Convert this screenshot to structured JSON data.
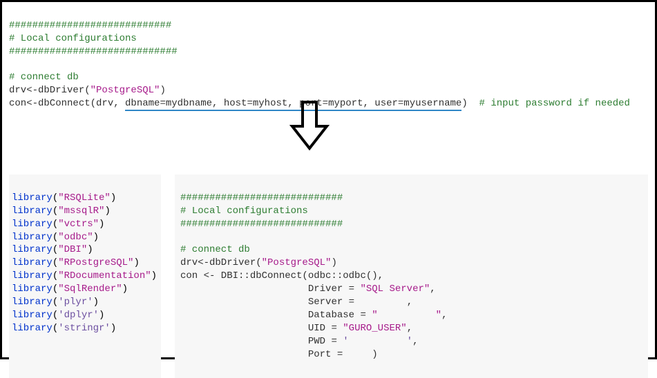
{
  "top": {
    "hash1": "############################",
    "title": "# Local configurations",
    "hash2": "#############################",
    "connect": "# connect db",
    "drv_prefix": "drv<-dbDriver(",
    "drv_str": "\"PostgreSQL\"",
    "drv_suffix": ")",
    "con_prefix": "con<-dbConnect(drv, ",
    "con_args_underlined": "dbname=mydbname, host=myhost, port=myport, user=myusername",
    "con_suffix": ")",
    "con_trailing_comment": "  # input password if needed"
  },
  "libs": [
    "\"RSQLite\"",
    "\"mssqlR\"",
    "\"vctrs\"",
    "\"odbc\"",
    "\"DBI\"",
    "\"RPostgreSQL\"",
    "\"RDocumentation\"",
    "\"SqlRender\"",
    "'plyr'",
    "'dplyr'",
    "'stringr'"
  ],
  "right": {
    "hash1": "############################",
    "title": "# Local configurations",
    "hash2": "############################",
    "connect": "# connect db",
    "drv_prefix": "drv<-dbDriver(",
    "drv_str": "\"PostgreSQL\"",
    "drv_suffix": ")",
    "con_line": "con <- DBI::dbConnect(odbc::odbc(),",
    "indent": "                      ",
    "driver_key": "Driver = ",
    "driver_val": "\"SQL Server\"",
    "server_key": "Server = ",
    "server_val": "        ",
    "database_key": "Database = ",
    "database_val": "\"          \"",
    "uid_key": "UID = ",
    "uid_val": "\"GURO_USER\"",
    "pwd_key": "PWD = ",
    "pwd_val": "'          '",
    "port_key": "Port = ",
    "port_val": "    ",
    "close": ")"
  }
}
